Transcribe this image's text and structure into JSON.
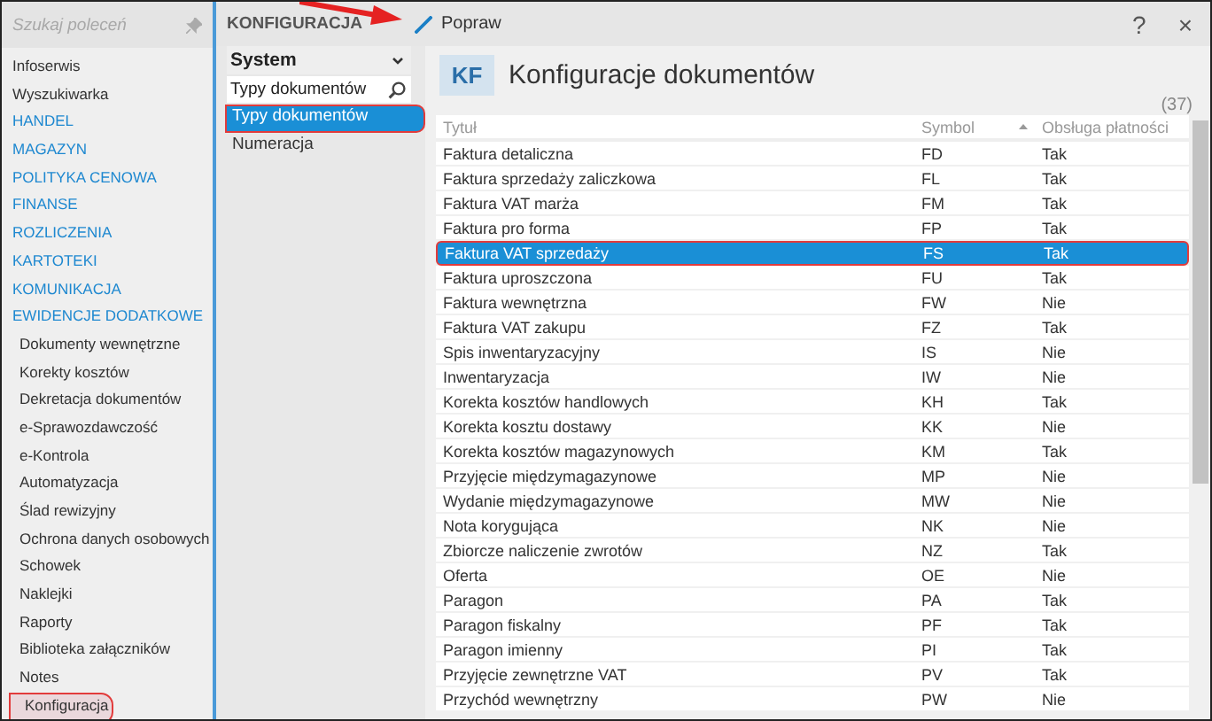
{
  "sidebar": {
    "search": {
      "placeholder": "Szukaj poleceń"
    },
    "items": [
      {
        "label": "Infoserwis",
        "kind": "item",
        "selected": false
      },
      {
        "label": "Wyszukiwarka",
        "kind": "item",
        "selected": false
      },
      {
        "label": "HANDEL",
        "kind": "section",
        "selected": false
      },
      {
        "label": "MAGAZYN",
        "kind": "section",
        "selected": false
      },
      {
        "label": "POLITYKA CENOWA",
        "kind": "section",
        "selected": false
      },
      {
        "label": "FINANSE",
        "kind": "section",
        "selected": false
      },
      {
        "label": "ROZLICZENIA",
        "kind": "section",
        "selected": false
      },
      {
        "label": "KARTOTEKI",
        "kind": "section",
        "selected": false
      },
      {
        "label": "KOMUNIKACJA",
        "kind": "section",
        "selected": false
      },
      {
        "label": "EWIDENCJE DODATKOWE",
        "kind": "section",
        "selected": false
      },
      {
        "label": "Dokumenty wewnętrzne",
        "kind": "sub",
        "selected": false
      },
      {
        "label": "Korekty kosztów",
        "kind": "sub",
        "selected": false
      },
      {
        "label": "Dekretacja dokumentów",
        "kind": "sub",
        "selected": false
      },
      {
        "label": "e-Sprawozdawczość",
        "kind": "sub",
        "selected": false
      },
      {
        "label": "e-Kontrola",
        "kind": "sub",
        "selected": false
      },
      {
        "label": "Automatyzacja",
        "kind": "sub",
        "selected": false
      },
      {
        "label": "Ślad rewizyjny",
        "kind": "sub",
        "selected": false
      },
      {
        "label": "Ochrona danych osobowych",
        "kind": "sub",
        "selected": false
      },
      {
        "label": "Schowek",
        "kind": "sub",
        "selected": false
      },
      {
        "label": "Naklejki",
        "kind": "sub",
        "selected": false
      },
      {
        "label": "Raporty",
        "kind": "sub",
        "selected": false
      },
      {
        "label": "Biblioteka załączników",
        "kind": "sub",
        "selected": false
      },
      {
        "label": "Notes",
        "kind": "sub",
        "selected": false
      },
      {
        "label": "Konfiguracja",
        "kind": "sub",
        "selected": true
      }
    ]
  },
  "panel": {
    "title": "KONFIGURACJA",
    "dropdown": "System",
    "search": {
      "value": "Typy dokumentów"
    },
    "items": [
      {
        "label": "Typy dokumentów",
        "selected": true
      },
      {
        "label": "Numeracja",
        "selected": false
      }
    ]
  },
  "toolbar": {
    "edit_button": "Popraw",
    "help": "?",
    "close": "×"
  },
  "content": {
    "badge": "KF",
    "title": "Konfiguracje dokumentów",
    "count": "(37)",
    "table": {
      "columns": [
        "Tytuł",
        "Symbol",
        "Obsługa płatności"
      ],
      "rows": [
        {
          "cells": [
            "Faktura detaliczna",
            "FD",
            "Tak"
          ],
          "selected": false
        },
        {
          "cells": [
            "Faktura sprzedaży zaliczkowa",
            "FL",
            "Tak"
          ],
          "selected": false
        },
        {
          "cells": [
            "Faktura VAT marża",
            "FM",
            "Tak"
          ],
          "selected": false
        },
        {
          "cells": [
            "Faktura pro forma",
            "FP",
            "Tak"
          ],
          "selected": false
        },
        {
          "cells": [
            "Faktura VAT sprzedaży",
            "FS",
            "Tak"
          ],
          "selected": true
        },
        {
          "cells": [
            "Faktura uproszczona",
            "FU",
            "Tak"
          ],
          "selected": false
        },
        {
          "cells": [
            "Faktura wewnętrzna",
            "FW",
            "Nie"
          ],
          "selected": false
        },
        {
          "cells": [
            "Faktura VAT zakupu",
            "FZ",
            "Tak"
          ],
          "selected": false
        },
        {
          "cells": [
            "Spis inwentaryzacyjny",
            "IS",
            "Nie"
          ],
          "selected": false
        },
        {
          "cells": [
            "Inwentaryzacja",
            "IW",
            "Nie"
          ],
          "selected": false
        },
        {
          "cells": [
            "Korekta kosztów handlowych",
            "KH",
            "Tak"
          ],
          "selected": false
        },
        {
          "cells": [
            "Korekta kosztu dostawy",
            "KK",
            "Nie"
          ],
          "selected": false
        },
        {
          "cells": [
            "Korekta kosztów magazynowych",
            "KM",
            "Tak"
          ],
          "selected": false
        },
        {
          "cells": [
            "Przyjęcie międzymagazynowe",
            "MP",
            "Nie"
          ],
          "selected": false
        },
        {
          "cells": [
            "Wydanie międzymagazynowe",
            "MW",
            "Nie"
          ],
          "selected": false
        },
        {
          "cells": [
            "Nota korygująca",
            "NK",
            "Nie"
          ],
          "selected": false
        },
        {
          "cells": [
            "Zbiorcze naliczenie zwrotów",
            "NZ",
            "Tak"
          ],
          "selected": false
        },
        {
          "cells": [
            "Oferta",
            "OE",
            "Nie"
          ],
          "selected": false
        },
        {
          "cells": [
            "Paragon",
            "PA",
            "Tak"
          ],
          "selected": false
        },
        {
          "cells": [
            "Paragon fiskalny",
            "PF",
            "Tak"
          ],
          "selected": false
        },
        {
          "cells": [
            "Paragon imienny",
            "PI",
            "Tak"
          ],
          "selected": false
        },
        {
          "cells": [
            "Przyjęcie zewnętrzne VAT",
            "PV",
            "Tak"
          ],
          "selected": false
        },
        {
          "cells": [
            "Przychód wewnętrzny",
            "PW",
            "Nie"
          ],
          "selected": false
        }
      ]
    }
  }
}
